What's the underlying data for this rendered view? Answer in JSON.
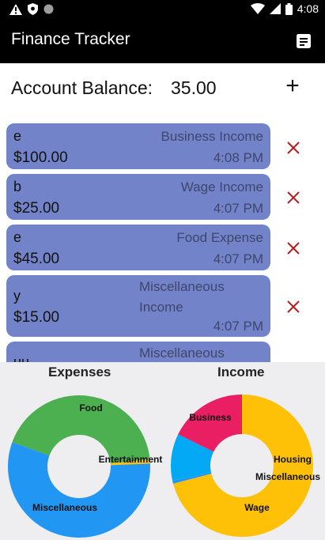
{
  "status_bar": {
    "time": "4:08",
    "left_icons": [
      "alert-icon",
      "shield-icon",
      "circle-icon"
    ],
    "right_icons": [
      "wifi-icon",
      "signal-icon",
      "battery-icon"
    ]
  },
  "app_bar": {
    "title": "Finance Tracker",
    "menu_icon": "notes-icon"
  },
  "balance": {
    "label": "Account Balance:",
    "value": "35.00",
    "add_label": "+"
  },
  "transactions": [
    {
      "name": "e",
      "amount": "$100.00",
      "category": "Business Income",
      "time": "4:08 PM"
    },
    {
      "name": "b",
      "amount": "$25.00",
      "category": "Wage Income",
      "time": "4:07 PM"
    },
    {
      "name": "e",
      "amount": "$45.00",
      "category": "Food Expense",
      "time": "4:07 PM"
    },
    {
      "name": "y",
      "amount": "$15.00",
      "category": "Miscellaneous Income",
      "time": "4:07 PM"
    },
    {
      "name": "uu",
      "amount": "",
      "category": "Miscellaneous",
      "time": ""
    }
  ],
  "delete_icon": "close-icon",
  "colors": {
    "card": "#7383c9",
    "delete": "#b71c1c",
    "food": "#4caf50",
    "miscellaneous": "#2196f3",
    "entertainment": "#ffc107",
    "business": "#ffc107",
    "wage": "#e91e63",
    "housing": "#2196f3",
    "misc_income": "#03a9f4"
  },
  "chart_data": [
    {
      "type": "pie",
      "title": "Expenses",
      "labels": [
        "Food",
        "Entertainment",
        "Miscellaneous"
      ],
      "values": [
        45,
        1,
        59
      ],
      "colors": [
        "#4caf50",
        "#ffc107",
        "#2196f3"
      ]
    },
    {
      "type": "pie",
      "title": "Income",
      "labels": [
        "Business",
        "Housing",
        "Miscellaneous",
        "Wage"
      ],
      "values": [
        100,
        1,
        15,
        25
      ],
      "colors": [
        "#ffc107",
        "#2196f3",
        "#03a9f4",
        "#e91e63"
      ]
    }
  ]
}
